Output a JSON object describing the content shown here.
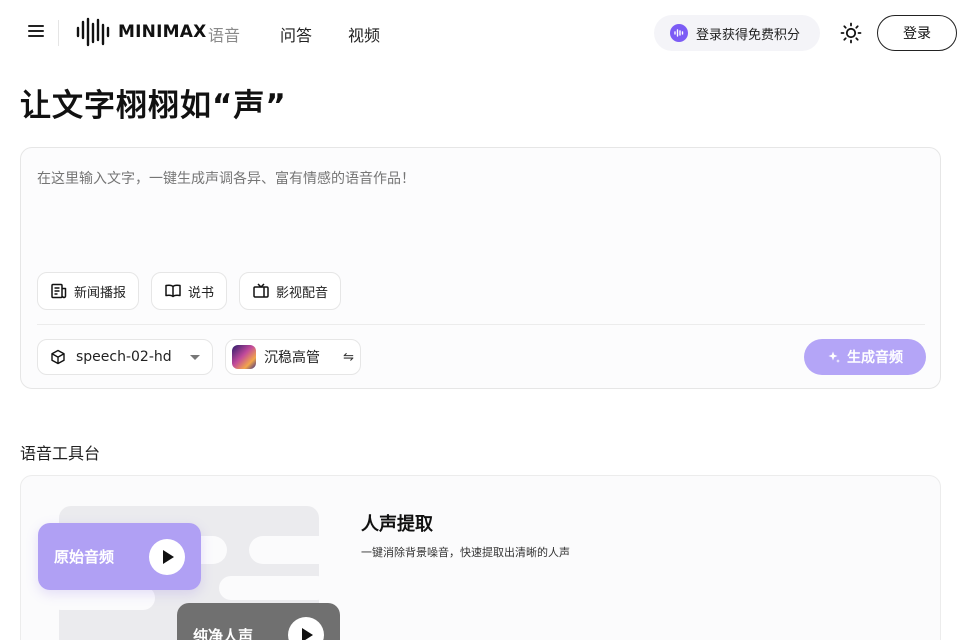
{
  "header": {
    "logo_text": "MINIMAX",
    "nav": [
      {
        "label": "语音",
        "active": true
      },
      {
        "label": "问答",
        "active": false
      },
      {
        "label": "视频",
        "active": false
      }
    ],
    "promo_text": "登录获得免费积分",
    "login_label": "登录",
    "accent_color": "#7c5cf5"
  },
  "hero": {
    "title": "让文字栩栩如“声”"
  },
  "composer": {
    "placeholder": "在这里输入文字，一键生成声调各异、富有情感的语音作品！",
    "tags": [
      {
        "label": "新闻播报",
        "icon": "newspaper-icon"
      },
      {
        "label": "说书",
        "icon": "book-icon"
      },
      {
        "label": "影视配音",
        "icon": "tv-icon"
      }
    ],
    "model": "speech-02-hd",
    "voice": "沉稳高管",
    "generate_label": "生成音频",
    "generate_color": "#b4a5f7"
  },
  "tools": {
    "section_title": "语音工具台",
    "card": {
      "title": "人声提取",
      "description": "一键消除背景噪音，快速提取出清晰的人声",
      "original_label": "原始音频",
      "clean_label": "纯净人声"
    }
  }
}
